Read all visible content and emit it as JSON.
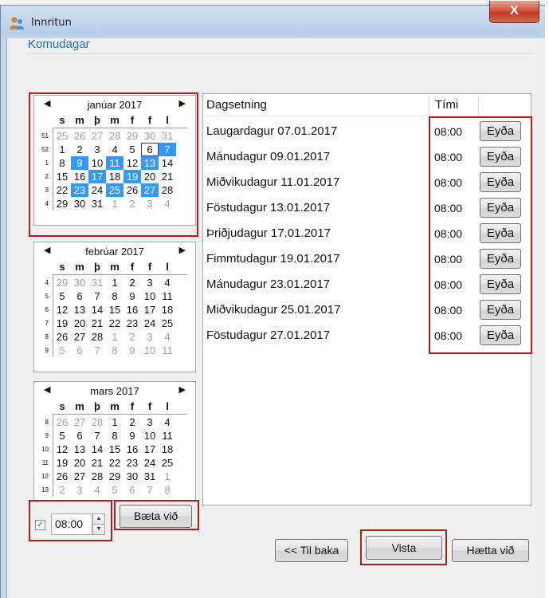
{
  "window": {
    "title": "Innritun",
    "close_label": "X"
  },
  "section": {
    "heading": "Komudagar"
  },
  "weekday_headers": [
    "s",
    "m",
    "þ",
    "m",
    "f",
    "f",
    "l"
  ],
  "calendars": [
    {
      "month": "janúar 2017",
      "weeks": [
        {
          "wk": "51",
          "days": [
            [
              "25",
              "out"
            ],
            [
              "26",
              "out"
            ],
            [
              "27",
              "out"
            ],
            [
              "28",
              "out"
            ],
            [
              "29",
              "out"
            ],
            [
              "30",
              "out"
            ],
            [
              "31",
              "out"
            ]
          ]
        },
        {
          "wk": "52",
          "days": [
            [
              "1",
              ""
            ],
            [
              "2",
              ""
            ],
            [
              "3",
              ""
            ],
            [
              "4",
              ""
            ],
            [
              "5",
              ""
            ],
            [
              "6",
              "today"
            ],
            [
              "7",
              "sel"
            ]
          ]
        },
        {
          "wk": "1",
          "days": [
            [
              "8",
              ""
            ],
            [
              "9",
              "sel"
            ],
            [
              "10",
              ""
            ],
            [
              "11",
              "sel"
            ],
            [
              "12",
              ""
            ],
            [
              "13",
              "sel"
            ],
            [
              "14",
              ""
            ]
          ]
        },
        {
          "wk": "2",
          "days": [
            [
              "15",
              ""
            ],
            [
              "16",
              ""
            ],
            [
              "17",
              "sel"
            ],
            [
              "18",
              ""
            ],
            [
              "19",
              "sel"
            ],
            [
              "20",
              ""
            ],
            [
              "21",
              ""
            ]
          ]
        },
        {
          "wk": "3",
          "days": [
            [
              "22",
              ""
            ],
            [
              "23",
              "sel"
            ],
            [
              "24",
              ""
            ],
            [
              "25",
              "sel"
            ],
            [
              "26",
              ""
            ],
            [
              "27",
              "sel"
            ],
            [
              "28",
              ""
            ]
          ]
        },
        {
          "wk": "4",
          "days": [
            [
              "29",
              ""
            ],
            [
              "30",
              ""
            ],
            [
              "31",
              ""
            ],
            [
              "1",
              "out"
            ],
            [
              "2",
              "out"
            ],
            [
              "3",
              "out"
            ],
            [
              "4",
              "out"
            ]
          ]
        }
      ]
    },
    {
      "month": "febrúar 2017",
      "weeks": [
        {
          "wk": "4",
          "days": [
            [
              "29",
              "out"
            ],
            [
              "30",
              "out"
            ],
            [
              "31",
              "out"
            ],
            [
              "1",
              ""
            ],
            [
              "2",
              ""
            ],
            [
              "3",
              ""
            ],
            [
              "4",
              ""
            ]
          ]
        },
        {
          "wk": "5",
          "days": [
            [
              "5",
              ""
            ],
            [
              "6",
              ""
            ],
            [
              "7",
              ""
            ],
            [
              "8",
              ""
            ],
            [
              "9",
              ""
            ],
            [
              "10",
              ""
            ],
            [
              "11",
              ""
            ]
          ]
        },
        {
          "wk": "6",
          "days": [
            [
              "12",
              ""
            ],
            [
              "13",
              ""
            ],
            [
              "14",
              ""
            ],
            [
              "15",
              ""
            ],
            [
              "16",
              ""
            ],
            [
              "17",
              ""
            ],
            [
              "18",
              ""
            ]
          ]
        },
        {
          "wk": "7",
          "days": [
            [
              "19",
              ""
            ],
            [
              "20",
              ""
            ],
            [
              "21",
              ""
            ],
            [
              "22",
              ""
            ],
            [
              "23",
              ""
            ],
            [
              "24",
              ""
            ],
            [
              "25",
              ""
            ]
          ]
        },
        {
          "wk": "8",
          "days": [
            [
              "26",
              ""
            ],
            [
              "27",
              ""
            ],
            [
              "28",
              ""
            ],
            [
              "1",
              "out"
            ],
            [
              "2",
              "out"
            ],
            [
              "3",
              "out"
            ],
            [
              "4",
              "out"
            ]
          ]
        },
        {
          "wk": "9",
          "days": [
            [
              "5",
              "out"
            ],
            [
              "6",
              "out"
            ],
            [
              "7",
              "out"
            ],
            [
              "8",
              "out"
            ],
            [
              "9",
              "out"
            ],
            [
              "10",
              "out"
            ],
            [
              "11",
              "out"
            ]
          ]
        }
      ]
    },
    {
      "month": "mars 2017",
      "weeks": [
        {
          "wk": "8",
          "days": [
            [
              "26",
              "out"
            ],
            [
              "27",
              "out"
            ],
            [
              "28",
              "out"
            ],
            [
              "1",
              ""
            ],
            [
              "2",
              ""
            ],
            [
              "3",
              ""
            ],
            [
              "4",
              ""
            ]
          ]
        },
        {
          "wk": "9",
          "days": [
            [
              "5",
              ""
            ],
            [
              "6",
              ""
            ],
            [
              "7",
              ""
            ],
            [
              "8",
              ""
            ],
            [
              "9",
              ""
            ],
            [
              "10",
              ""
            ],
            [
              "11",
              ""
            ]
          ]
        },
        {
          "wk": "10",
          "days": [
            [
              "12",
              ""
            ],
            [
              "13",
              ""
            ],
            [
              "14",
              ""
            ],
            [
              "15",
              ""
            ],
            [
              "16",
              ""
            ],
            [
              "17",
              ""
            ],
            [
              "18",
              ""
            ]
          ]
        },
        {
          "wk": "11",
          "days": [
            [
              "19",
              ""
            ],
            [
              "20",
              ""
            ],
            [
              "21",
              ""
            ],
            [
              "22",
              ""
            ],
            [
              "23",
              ""
            ],
            [
              "24",
              ""
            ],
            [
              "25",
              ""
            ]
          ]
        },
        {
          "wk": "12",
          "days": [
            [
              "26",
              ""
            ],
            [
              "27",
              ""
            ],
            [
              "28",
              ""
            ],
            [
              "29",
              ""
            ],
            [
              "30",
              ""
            ],
            [
              "31",
              ""
            ],
            [
              "1",
              "out"
            ]
          ]
        },
        {
          "wk": "13",
          "days": [
            [
              "2",
              "out"
            ],
            [
              "3",
              "out"
            ],
            [
              "4",
              "out"
            ],
            [
              "5",
              "out"
            ],
            [
              "6",
              "out"
            ],
            [
              "7",
              "out"
            ],
            [
              "8",
              "out"
            ]
          ]
        }
      ]
    }
  ],
  "time_control": {
    "checked": true,
    "value": "08:00"
  },
  "add_button": {
    "label": "Bæta við"
  },
  "list": {
    "headers": {
      "date": "Dagsetning",
      "time": "Tími"
    },
    "delete_label": "Eyða",
    "rows": [
      {
        "date": "Laugardagur 07.01.2017",
        "time": "08:00"
      },
      {
        "date": "Mánudagur 09.01.2017",
        "time": "08:00"
      },
      {
        "date": "Miðvikudagur 11.01.2017",
        "time": "08:00"
      },
      {
        "date": "Föstudagur 13.01.2017",
        "time": "08:00"
      },
      {
        "date": "Þriðjudagur 17.01.2017",
        "time": "08:00"
      },
      {
        "date": "Fimmtudagur 19.01.2017",
        "time": "08:00"
      },
      {
        "date": "Mánudagur 23.01.2017",
        "time": "08:00"
      },
      {
        "date": "Miðvikudagur 25.01.2017",
        "time": "08:00"
      },
      {
        "date": "Föstudagur 27.01.2017",
        "time": "08:00"
      }
    ]
  },
  "footer": {
    "back_label": "<< Til baka",
    "show_label": "Vista",
    "cancel_label": "Hætta við"
  },
  "colors": {
    "selected_day": "#3399ff",
    "highlight": "#b01d1d",
    "heading": "#1f6fc4"
  }
}
